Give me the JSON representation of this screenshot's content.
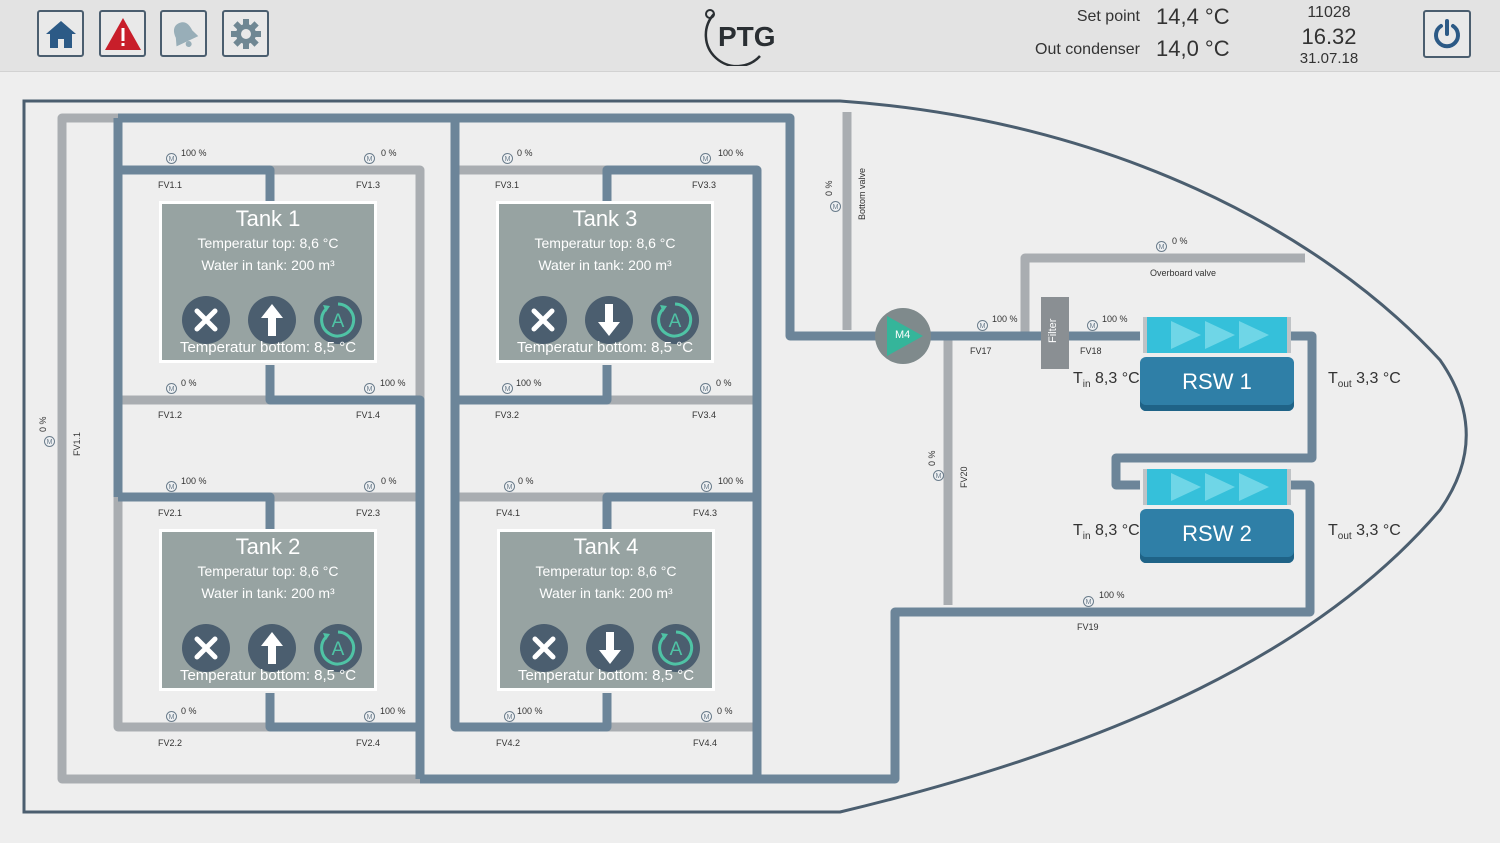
{
  "toolbar": {
    "home_icon": "home-icon",
    "alarm_icon": "warning-icon",
    "bell_icon": "bell-icon",
    "settings_icon": "gear-icon",
    "power_icon": "power-icon"
  },
  "header": {
    "logo": "PTG",
    "set_point_label": "Set point",
    "set_point_value": "14,4 °C",
    "out_condenser_label": "Out condenser",
    "out_condenser_value": "14,0 °C",
    "code": "11028",
    "time": "16.32",
    "date": "31.07.18"
  },
  "tanks": [
    {
      "name": "Tank 1",
      "top": "Temperatur top:  8,6 °C",
      "water": "Water in tank: 200 m³",
      "bottom": "Temperatur bottom: 8,5 °C",
      "direction": "up"
    },
    {
      "name": "Tank 2",
      "top": "Temperatur top:  8,6 °C",
      "water": "Water in tank: 200 m³",
      "bottom": "Temperatur bottom: 8,5 °C",
      "direction": "up"
    },
    {
      "name": "Tank 3",
      "top": "Temperatur top:  8,6 °C",
      "water": "Water in tank: 200 m³",
      "bottom": "Temperatur bottom: 8,5 °C",
      "direction": "down"
    },
    {
      "name": "Tank 4",
      "top": "Temperatur top:  8,6 °C",
      "water": "Water in tank: 200 m³",
      "bottom": "Temperatur bottom: 8,5 °C",
      "direction": "down"
    }
  ],
  "valves": {
    "FV1_1": {
      "label": "FV1.1",
      "pct": "100 %"
    },
    "FV1_3": {
      "label": "FV1.3",
      "pct": "0 %"
    },
    "FV1_2": {
      "label": "FV1.2",
      "pct": "0 %"
    },
    "FV1_4": {
      "label": "FV1.4",
      "pct": "100 %"
    },
    "FV2_1": {
      "label": "FV2.1",
      "pct": "100 %"
    },
    "FV2_3": {
      "label": "FV2.3",
      "pct": "0 %"
    },
    "FV2_2": {
      "label": "FV2.2",
      "pct": "0 %"
    },
    "FV2_4": {
      "label": "FV2.4",
      "pct": "100 %"
    },
    "FV3_1": {
      "label": "FV3.1",
      "pct": "0 %"
    },
    "FV3_3": {
      "label": "FV3.3",
      "pct": "100 %"
    },
    "FV3_2": {
      "label": "FV3.2",
      "pct": "100 %"
    },
    "FV3_4": {
      "label": "FV3.4",
      "pct": "0 %"
    },
    "FV4_1": {
      "label": "FV4.1",
      "pct": "0 %"
    },
    "FV4_3": {
      "label": "FV4.3",
      "pct": "100 %"
    },
    "FV4_2": {
      "label": "FV4.2",
      "pct": "100 %"
    },
    "FV4_4": {
      "label": "FV4.4",
      "pct": "0 %"
    },
    "FV1_1_side": {
      "label": "FV1.1",
      "pct": "0 %"
    },
    "FV17": {
      "label": "FV17",
      "pct": "100 %"
    },
    "FV18": {
      "label": "FV18",
      "pct": "100 %"
    },
    "FV19": {
      "label": "FV19",
      "pct": "100 %"
    },
    "FV20": {
      "label": "FV20",
      "pct": "0 %"
    },
    "bottom": {
      "label": "Bottom valve",
      "pct": "0 %"
    },
    "overboard": {
      "label": "Overboard valve",
      "pct": "0 %"
    }
  },
  "pump": {
    "label": "M4"
  },
  "filter": {
    "label": "Filter"
  },
  "rsw": [
    {
      "name": "RSW 1",
      "t_in": "8,3 °C",
      "t_out": "3,3 °C"
    },
    {
      "name": "RSW 2",
      "t_in": "8,3 °C",
      "t_out": "3,3 °C"
    }
  ],
  "colors": {
    "pipe_active": "#6c8599",
    "pipe_idle": "#a9adb1",
    "tank": "#97a3a2",
    "button": "#4b5e6f",
    "rsw": "#2f7fa7",
    "rsw_top": "#35c0da",
    "hull": "#4b5e6f"
  }
}
